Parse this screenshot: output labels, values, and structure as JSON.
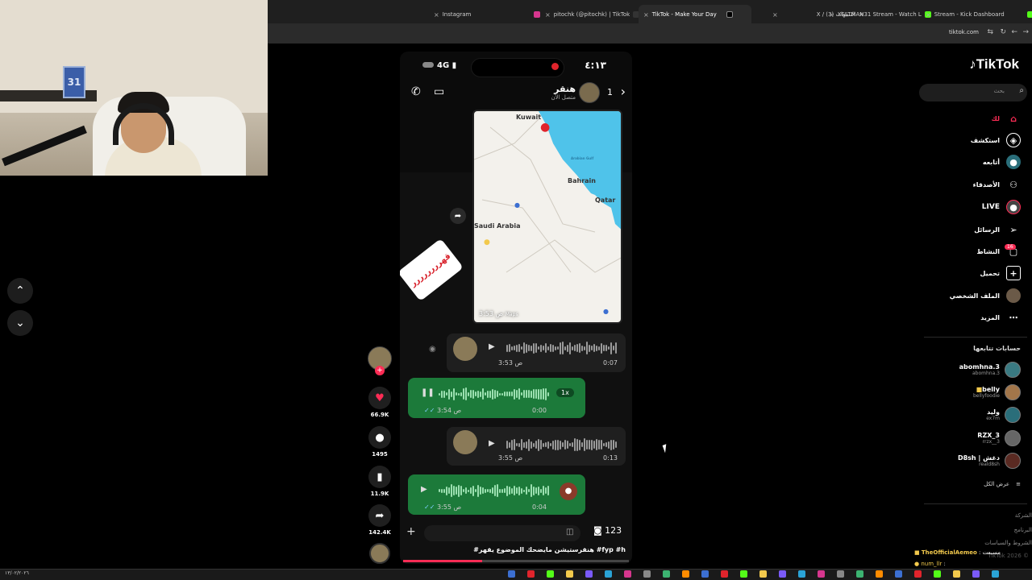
{
  "browser": {
    "tabs": [
      {
        "label": "Instagram"
      },
      {
        "label": "pitochk (@pitochk) | TikTok"
      },
      {
        "label": "TikTok - Make Your Day"
      },
      {
        "label": "X / (3) التنبيهات"
      },
      {
        "label": "XFATMAN31 Stream - Watch L"
      },
      {
        "label": "Stream - Kick Dashboard"
      }
    ],
    "url": "tiktok.com"
  },
  "webcam": {
    "jersey_number": "31"
  },
  "phone": {
    "status_time": "٤:١٣",
    "network": "4G",
    "contact_name": "هنقر",
    "contact_status": "متصل الآن",
    "back_count": "1",
    "map": {
      "labels": {
        "kuwait": "Kuwait",
        "bahrain": "Bahrain",
        "qatar": "Qatar",
        "saudi": "Saudi Arabia",
        "gulf": "Arabian Gulf"
      },
      "timestamp": "3:53 ص",
      "maps_brand": "Maps"
    },
    "sticker_text": "قهرررررررر",
    "voice_messages": [
      {
        "time": "3:53 ص",
        "duration": "0:07",
        "direction": "in"
      },
      {
        "time": "3:54 ص",
        "duration": "0:00",
        "direction": "out",
        "speed": "1x",
        "playing": true
      },
      {
        "time": "3:55 ص",
        "duration": "0:13",
        "direction": "in"
      },
      {
        "time": "3:55 ص",
        "duration": "0:04",
        "direction": "out"
      }
    ],
    "sticker_count": "123",
    "caption": "#هنقرستيشن مايضحك الموضوع يقهر #fyp #h",
    "progress": 0.35
  },
  "actions": {
    "likes": "66.9K",
    "comments": "1495",
    "saves": "11.9K",
    "shares": "142.4K"
  },
  "tiktok": {
    "logo": "TikTok",
    "search_placeholder": "بحث",
    "nav": [
      {
        "label": "لك",
        "icon": "home-icon"
      },
      {
        "label": "استكشف",
        "icon": "compass-icon"
      },
      {
        "label": "أتابعه",
        "icon": "following-icon"
      },
      {
        "label": "الأصدقاء",
        "icon": "friends-icon"
      },
      {
        "label": "LIVE",
        "icon": "live-icon"
      },
      {
        "label": "الرسائل",
        "icon": "send-icon"
      },
      {
        "label": "النشاط",
        "icon": "activity-icon",
        "badge": "16"
      },
      {
        "label": "تحميل",
        "icon": "upload-icon"
      },
      {
        "label": "الملف الشخصي",
        "icon": "profile-icon"
      },
      {
        "label": "المزيد",
        "icon": "more-icon"
      }
    ],
    "following_heading": "حسابات تتابعها",
    "accounts": [
      {
        "name": "abomhna.3",
        "handle": "abomhna.3"
      },
      {
        "name": "belly",
        "handle": "bellyfoodie"
      },
      {
        "name": "وليد",
        "handle": "ex7m"
      },
      {
        "name": "RZX_3",
        "handle": "rrzx__3"
      },
      {
        "name": "D8sh | دغش",
        "handle": "reald8sh"
      }
    ],
    "see_all": "عرض الكل",
    "footer": [
      "الشركة",
      "البرنامج",
      "الشروط والسياسات",
      "TikTok 2026 ©"
    ]
  },
  "chat": {
    "line1_user": "TheOfficialAemeo",
    "line1_text": ": مسبعت",
    "line2_user": "num_llr",
    "line2_text": ":"
  },
  "taskbar": {
    "date_text": "١٣/٠٢/٢٠٢٦"
  },
  "colors": {
    "accent": "#fe2c55",
    "bubble_out": "#1c7a3a",
    "sea": "#4fc3ea"
  }
}
